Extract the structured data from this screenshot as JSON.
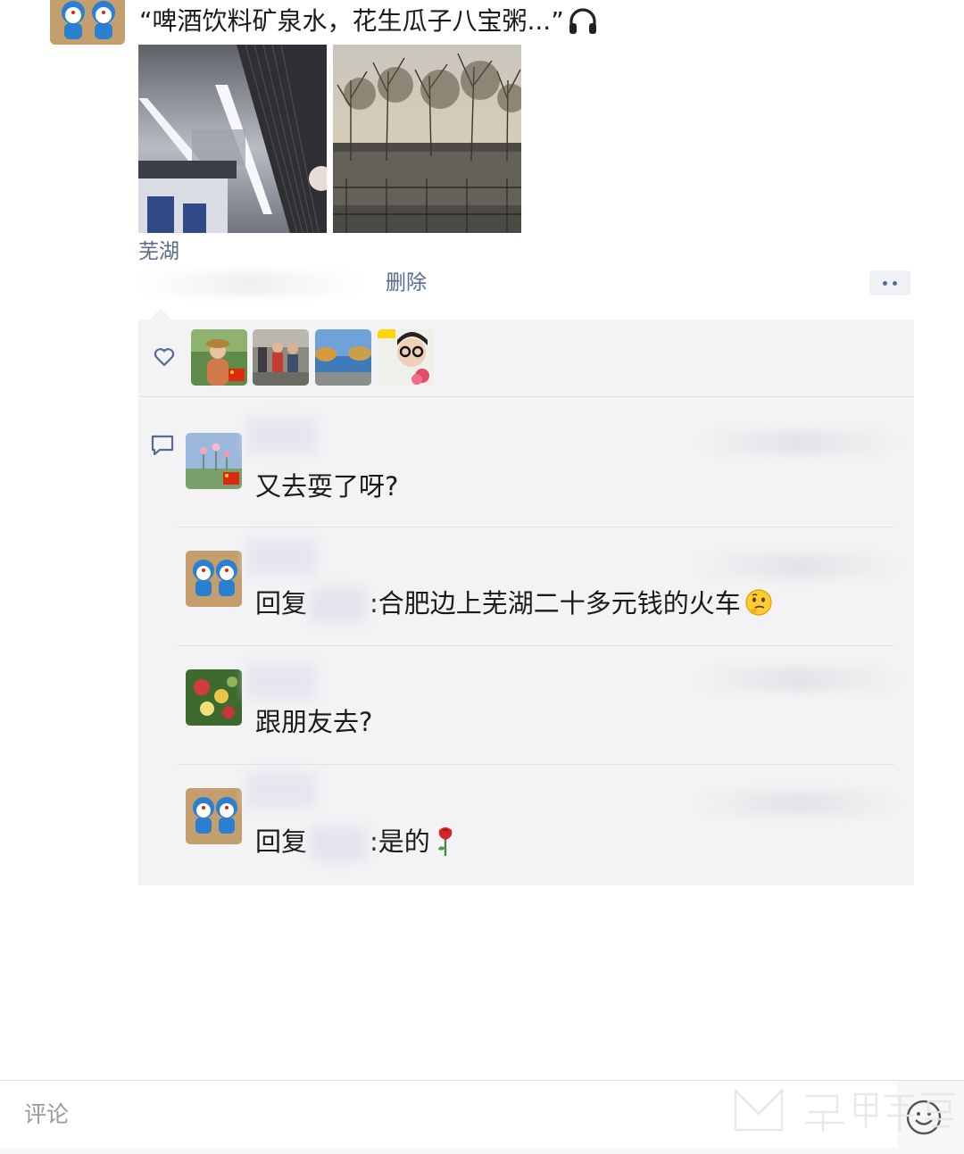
{
  "post": {
    "text": "“啤酒饮料矿泉水，花生瓜子八宝粥...”",
    "location": "芜湖",
    "delete_label": "删除"
  },
  "likes": {
    "count": 4
  },
  "comments": [
    {
      "text": "又去耍了呀?"
    },
    {
      "reply_prefix": "回复",
      "text": ":合肥边上芜湖二十多元钱的火车"
    },
    {
      "text": "跟朋友去?"
    },
    {
      "reply_prefix": "回复",
      "text": ":是的"
    }
  ],
  "comment_bar": {
    "placeholder": "评论"
  },
  "colors": {
    "link": "#576b95",
    "panel_bg": "#f3f3f5"
  },
  "icons": [
    "headphones-icon",
    "heart-icon",
    "comment-icon",
    "more-icon",
    "emoji-icon"
  ]
}
